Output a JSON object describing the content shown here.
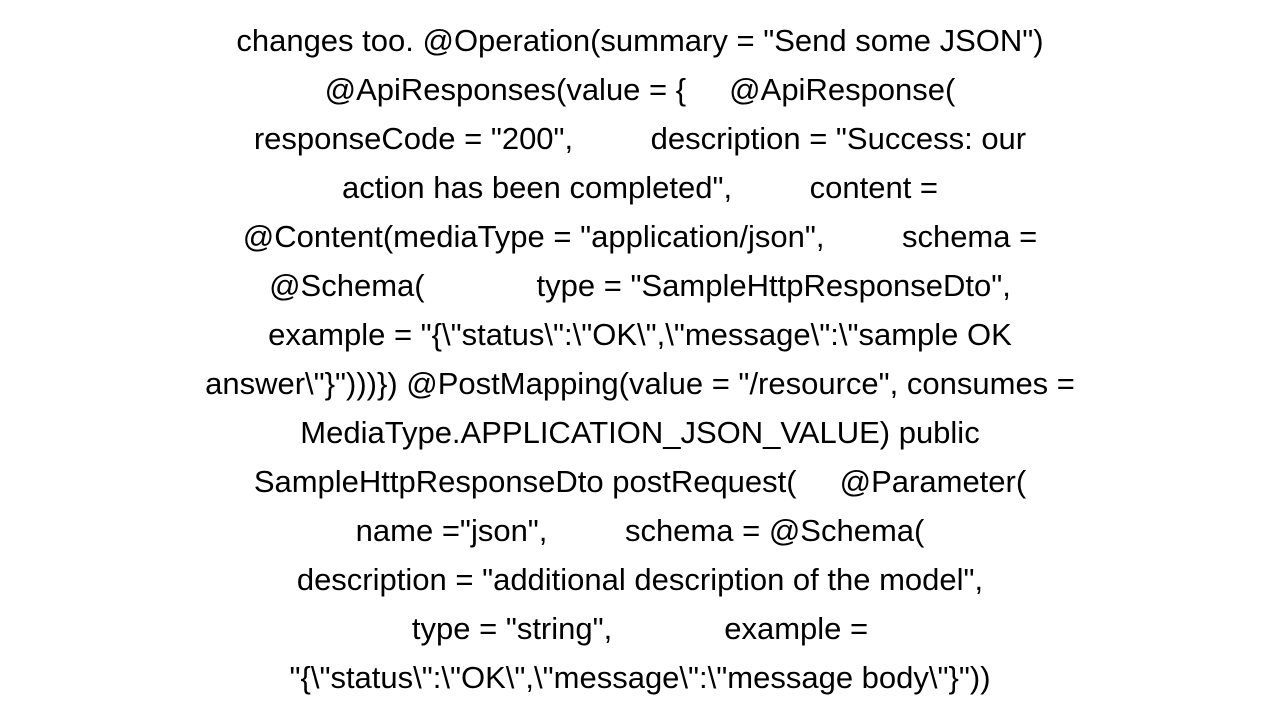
{
  "text": "changes too. @Operation(summary = \"Send some JSON\")\n@ApiResponses(value = {     @ApiResponse(\nresponseCode = \"200\",         description = \"Success: our\naction has been completed\",         content =\n@Content(mediaType = \"application/json\",         schema =\n@Schema(             type = \"SampleHttpResponseDto\",\nexample = \"{\\\"status\\\":\\\"OK\\\",\\\"message\\\":\\\"sample OK\nanswer\\\"}\")))}) @PostMapping(value = \"/resource\", consumes =\nMediaType.APPLICATION_JSON_VALUE) public\nSampleHttpResponseDto postRequest(     @Parameter(\nname =\"json\",         schema = @Schema(\ndescription = \"additional description of the model\",\ntype = \"string\",             example =\n\"{\\\"status\\\":\\\"OK\\\",\\\"message\\\":\\\"message body\\\"}\"))"
}
